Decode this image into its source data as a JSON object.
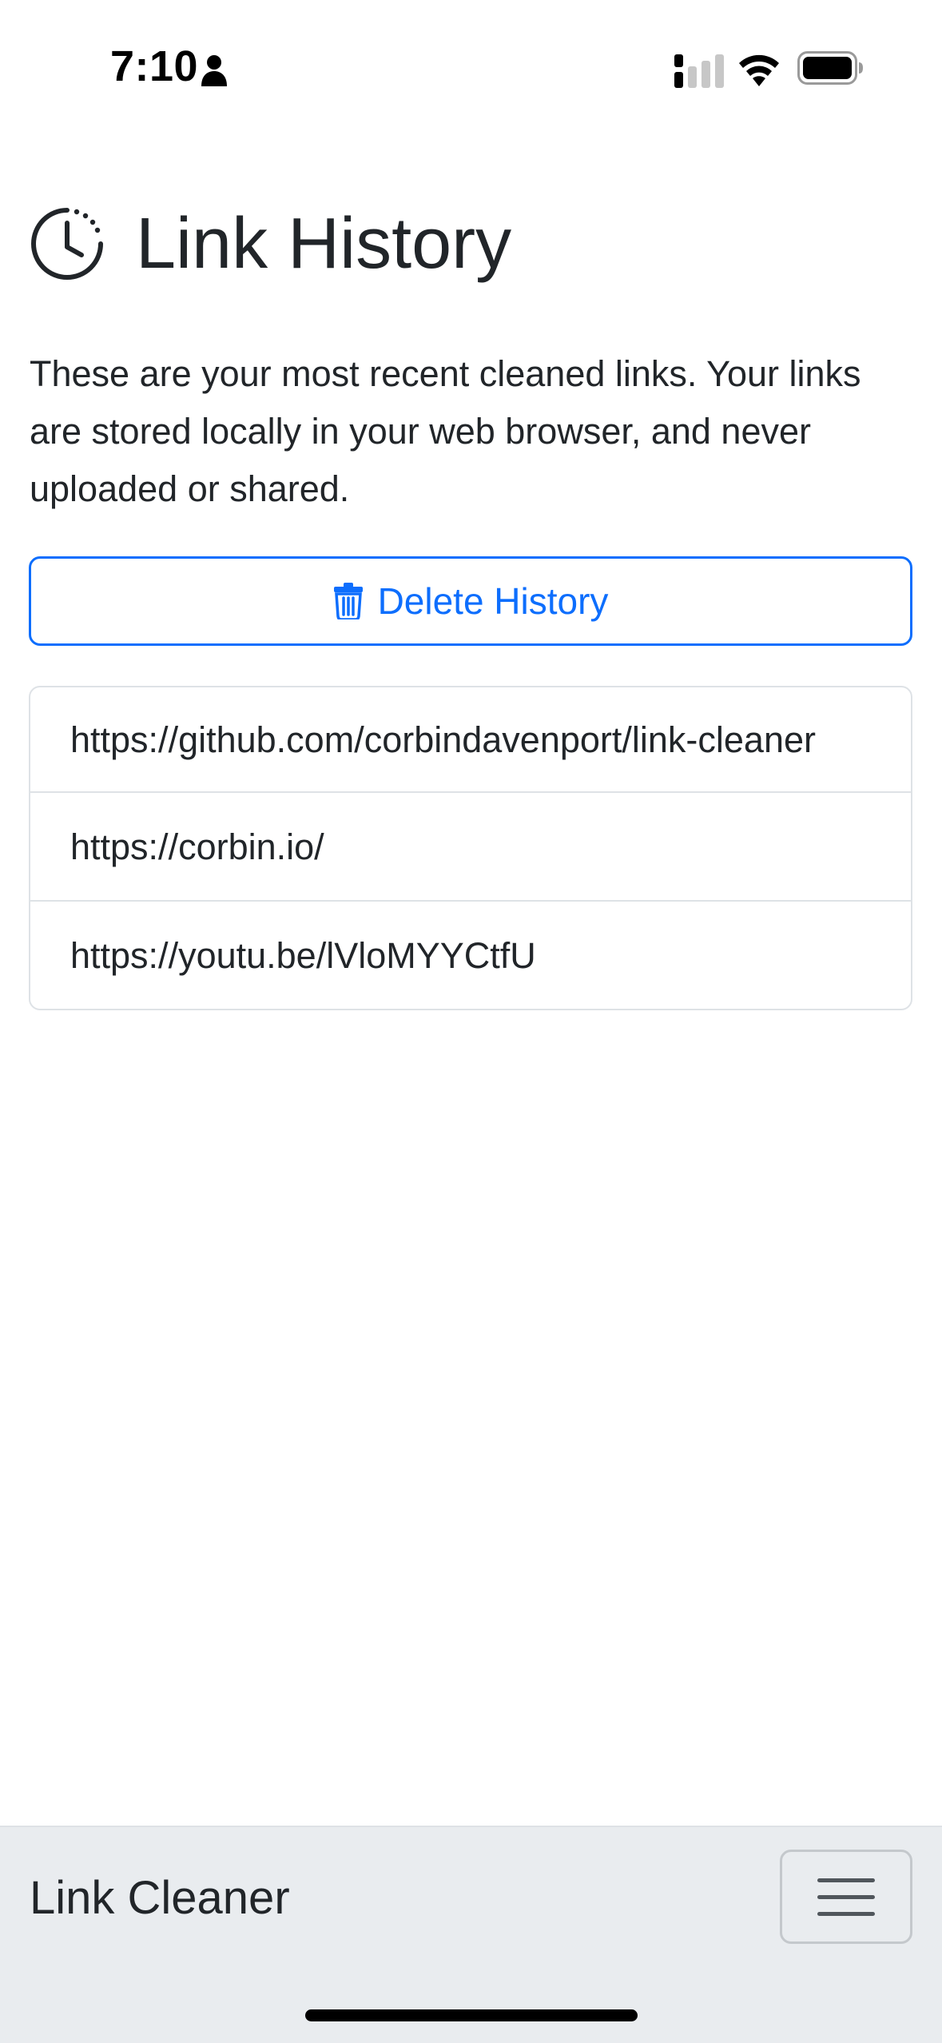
{
  "status_bar": {
    "time": "7:10"
  },
  "header": {
    "title": "Link History"
  },
  "intro": {
    "text": "These are your most recent cleaned links. Your links are stored locally in your web browser, and never uploaded or shared."
  },
  "actions": {
    "delete_label": "Delete History"
  },
  "history": {
    "items": [
      "https://github.com/corbindavenport/link-cleaner",
      "https://corbin.io/",
      "https://youtu.be/lVloMYYCtfU"
    ]
  },
  "navbar": {
    "brand": "Link Cleaner"
  },
  "colors": {
    "accent": "#0d6efd",
    "navbar_bg": "#e9ecef",
    "text": "#212529",
    "border": "#dee2e6"
  }
}
